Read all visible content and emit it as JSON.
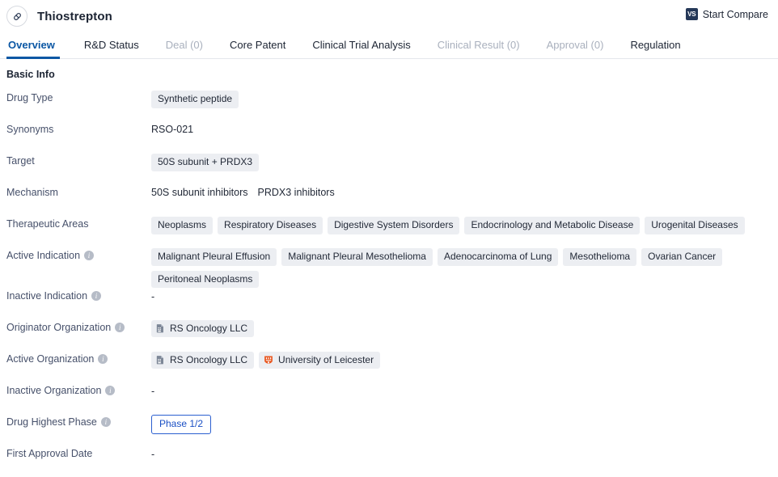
{
  "header": {
    "drug_name": "Thiostrepton",
    "avatar_icon": "capsule-pill-icon",
    "compare": {
      "badge": "VS",
      "label": "Start Compare"
    }
  },
  "tabs": [
    {
      "label": "Overview",
      "state": "active"
    },
    {
      "label": "R&D Status",
      "state": "normal"
    },
    {
      "label": "Deal (0)",
      "state": "disabled"
    },
    {
      "label": "Core Patent",
      "state": "normal"
    },
    {
      "label": "Clinical Trial Analysis",
      "state": "normal"
    },
    {
      "label": "Clinical Result (0)",
      "state": "disabled"
    },
    {
      "label": "Approval (0)",
      "state": "disabled"
    },
    {
      "label": "Regulation",
      "state": "normal"
    }
  ],
  "section": {
    "title": "Basic Info"
  },
  "fields": {
    "drug_type": {
      "label": "Drug Type",
      "tags": [
        "Synthetic peptide"
      ]
    },
    "synonyms": {
      "label": "Synonyms",
      "text": "RSO-021"
    },
    "target": {
      "label": "Target",
      "tags": [
        "50S subunit + PRDX3"
      ]
    },
    "mechanism": {
      "label": "Mechanism",
      "items": [
        "50S subunit inhibitors",
        "PRDX3 inhibitors"
      ]
    },
    "therapeutic_areas": {
      "label": "Therapeutic Areas",
      "tags": [
        "Neoplasms",
        "Respiratory Diseases",
        "Digestive System Disorders",
        "Endocrinology and Metabolic Disease",
        "Urogenital Diseases"
      ]
    },
    "active_indication": {
      "label": "Active Indication",
      "info": true,
      "tags": [
        "Malignant Pleural Effusion",
        "Malignant Pleural Mesothelioma",
        "Adenocarcinoma of Lung",
        "Mesothelioma",
        "Ovarian Cancer",
        "Peritoneal Neoplasms"
      ]
    },
    "inactive_indication": {
      "label": "Inactive Indication",
      "info": true,
      "value": "-"
    },
    "originator_organization": {
      "label": "Originator Organization",
      "info": true,
      "orgs": [
        {
          "name": "RS Oncology LLC",
          "icon": "company-building-icon"
        }
      ]
    },
    "active_organization": {
      "label": "Active Organization",
      "info": true,
      "orgs": [
        {
          "name": "RS Oncology LLC",
          "icon": "company-building-icon"
        },
        {
          "name": "University of Leicester",
          "icon": "university-shield-icon"
        }
      ]
    },
    "inactive_organization": {
      "label": "Inactive Organization",
      "info": true,
      "value": "-"
    },
    "drug_highest_phase": {
      "label": "Drug Highest Phase",
      "info": true,
      "badge": "Phase 1/2"
    },
    "first_approval_date": {
      "label": "First Approval Date",
      "value": "-"
    }
  },
  "colors": {
    "accent": "#0b57a4",
    "tag_bg": "#eceef2",
    "text": "#232a38",
    "label": "#46506a",
    "phase_border": "#2b5fd0",
    "university_icon": "#e8561f",
    "vs_badge_bg": "#253858"
  }
}
